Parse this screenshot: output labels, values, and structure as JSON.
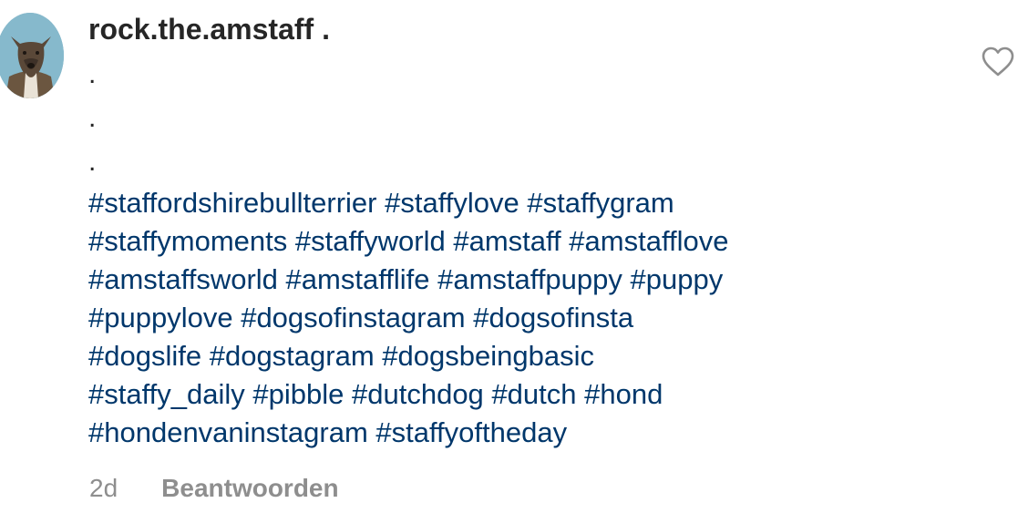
{
  "comment": {
    "username": "rock.the.amstaff",
    "username_suffix": " .",
    "dots": [
      ".",
      ".",
      "."
    ],
    "hashtag_lines": [
      [
        "#staffordshirebullterrier",
        "#staffylove",
        "#staffygram"
      ],
      [
        "#staffymoments",
        "#staffyworld",
        "#amstaff",
        "#amstafflove"
      ],
      [
        "#amstaffsworld",
        "#amstafflife",
        "#amstaffpuppy",
        "#puppy"
      ],
      [
        "#puppylove",
        "#dogsofinstagram",
        "#dogsofinsta"
      ],
      [
        "#dogslife",
        "#dogstagram",
        "#dogsbeingbasic"
      ],
      [
        "#staffy_daily",
        "#pibble",
        "#dutchdog",
        "#dutch",
        "#hond"
      ],
      [
        "#hondenvaninstagram",
        "#staffyoftheday"
      ]
    ],
    "timestamp": "2d",
    "reply_label": "Beantwoorden"
  },
  "icons": {
    "avatar": "dog-profile-photo",
    "like": "heart-outline-icon"
  },
  "colors": {
    "text": "#262626",
    "hashtag": "#00376b",
    "meta": "#8e8e8e",
    "icon": "#8e8e8e"
  }
}
